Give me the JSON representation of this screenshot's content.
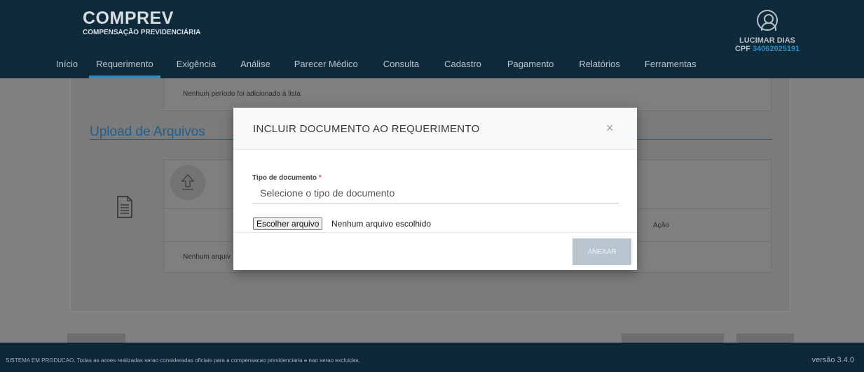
{
  "brand": {
    "title": "COMPREV",
    "subtitle": "COMPENSAÇÃO PREVIDENCIÁRIA"
  },
  "nav": {
    "items": [
      {
        "label": "Início"
      },
      {
        "label": "Requerimento"
      },
      {
        "label": "Exigência"
      },
      {
        "label": "Análise"
      },
      {
        "label": "Parecer Médico"
      },
      {
        "label": "Consulta"
      },
      {
        "label": "Cadastro"
      },
      {
        "label": "Pagamento"
      },
      {
        "label": "Relatórios"
      },
      {
        "label": "Ferramentas"
      }
    ],
    "active": "Requerimento"
  },
  "user": {
    "name": "LUCIMAR DIAS",
    "cpf_label": "CPF",
    "cpf_value": "34062025191",
    "icon": "user-circle-icon"
  },
  "background": {
    "period_empty": "Nenhum período foi adicionado à lista",
    "upload_section_title": "Upload de Arquivos",
    "table_action_header": "Ação",
    "files_empty": "Nenhum arquiv"
  },
  "modal": {
    "title": "INCLUIR DOCUMENTO AO REQUERIMENTO",
    "close_icon": "×",
    "doc_type_label": "Tipo de documento",
    "required_mark": "*",
    "doc_type_placeholder": "Selecione o tipo de documento",
    "file_button": "Escolher arquivo",
    "file_status": "Nenhum arquivo escolhido",
    "attach_button": "ANEXAR"
  },
  "footer": {
    "notice": "SISTEMA EM PRODUCAO. Todas as acoes realizadas serao consideradas oficiais para a compensacao previdenciaria e nao serao excluidas.",
    "version": "versão 3.4.0"
  },
  "colors": {
    "header_bg": "#0f2a3a",
    "accent": "#2f8bc2",
    "footer_bg": "#0d2736"
  }
}
